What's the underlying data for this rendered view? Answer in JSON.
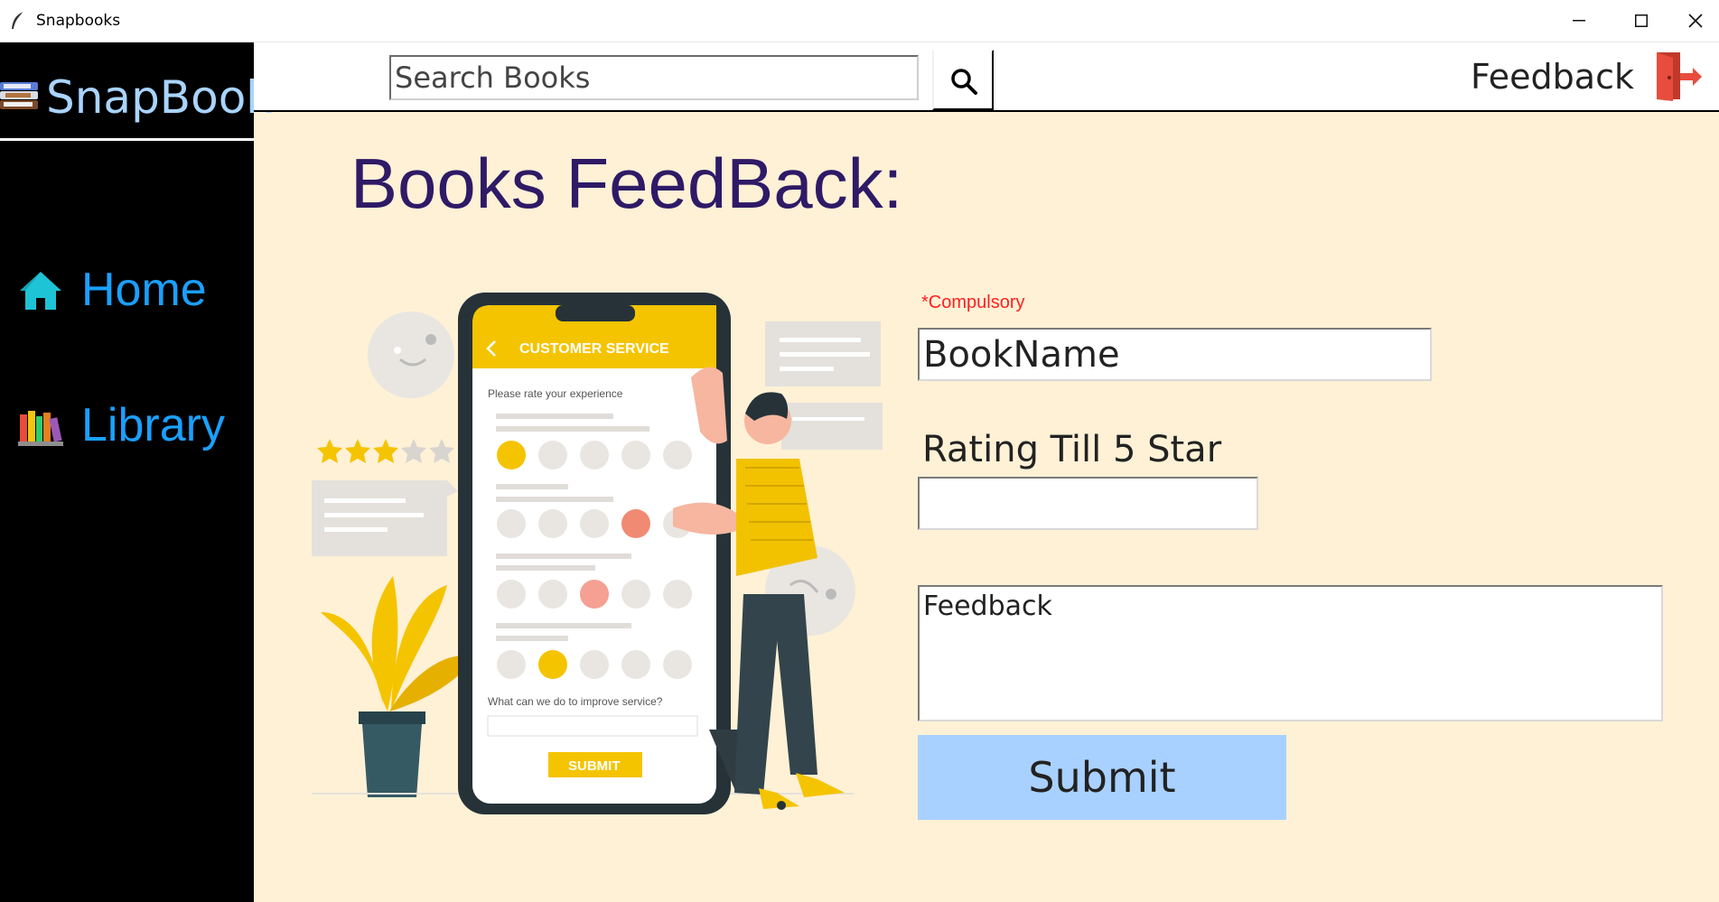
{
  "window": {
    "title": "Snapbooks",
    "icon": "feather-icon",
    "controls": [
      "minimize-icon",
      "maximize-icon",
      "close-icon"
    ]
  },
  "sidebar": {
    "brand": {
      "text": "SnapBook",
      "icon": "books-icon"
    },
    "items": [
      {
        "label": "Home",
        "icon": "home-icon"
      },
      {
        "label": "Library",
        "icon": "bookshelf-icon"
      }
    ]
  },
  "header": {
    "search": {
      "placeholder": "Search Books",
      "button_icon": "search-icon"
    },
    "nav_feedback": "Feedback",
    "logout_icon": "exit-door-icon"
  },
  "main": {
    "title": "Books FeedBack:",
    "illustration": {
      "screen_header": "CUSTOMER SERVICE",
      "prompt": "Please rate your experience",
      "question": "What can we do to improve service?",
      "submit": "SUBMIT"
    },
    "form": {
      "required_note": "*Compulsory",
      "book_name_placeholder": "BookName",
      "rating_label": "Rating Till 5 Star",
      "rating_value": "",
      "feedback_placeholder": "Feedback",
      "submit_label": "Submit"
    }
  },
  "colors": {
    "background": "#fff1d6",
    "sidebar": "#000000",
    "brand_text": "#a9d4ff",
    "nav_text": "#1aa0ff",
    "title": "#2e1a66",
    "required": "#ff2020",
    "submit_bg": "#a9d1ff",
    "illustration_accent": "#f5c400"
  }
}
